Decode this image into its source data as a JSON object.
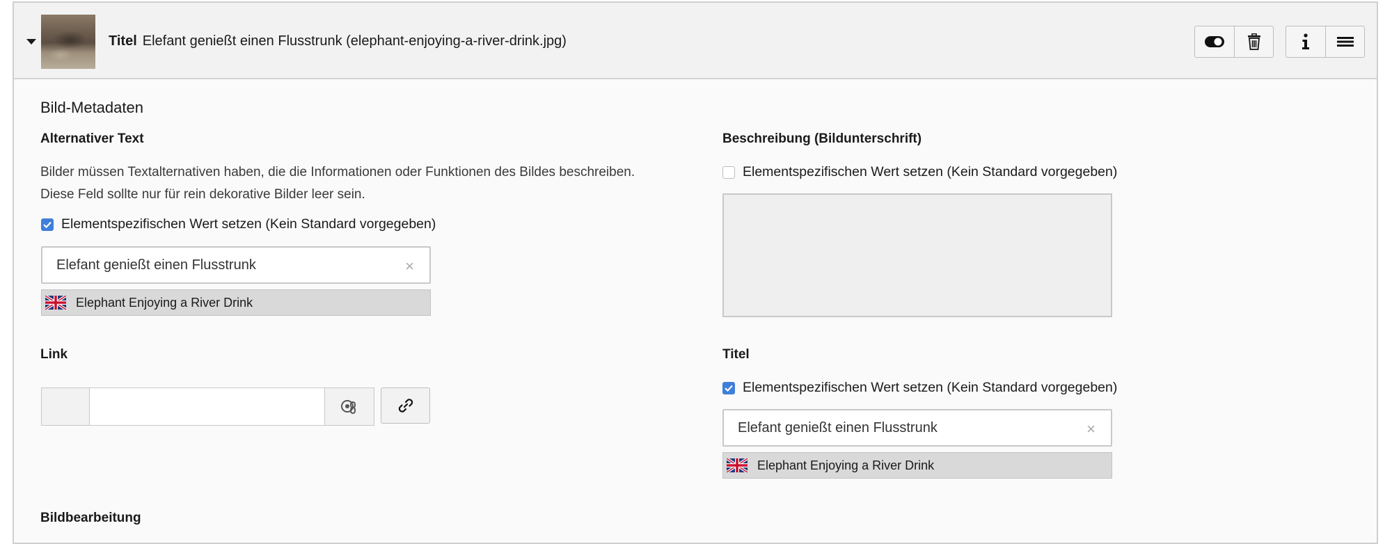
{
  "header": {
    "title_label": "Titel",
    "title_value": "Elefant genießt einen Flusstrunk (elephant-enjoying-a-river-drink.jpg)",
    "buttons": {
      "toggle": "toggle-visibility-icon",
      "delete": "trash-icon",
      "info": "info-icon",
      "menu": "menu-icon"
    }
  },
  "section": {
    "title": "Bild-Metadaten"
  },
  "alt_text": {
    "label": "Alternativer Text",
    "help_line1": "Bilder müssen Textalternativen haben, die die Informationen oder Funktionen des Bildes beschreiben.",
    "help_line2": "Diese Feld sollte nur für rein dekorative Bilder leer sein.",
    "checkbox_label": "Elementspezifischen Wert setzen (Kein Standard vorgegeben)",
    "checked": true,
    "value": "Elefant genießt einen Flusstrunk",
    "clear_symbol": "×",
    "translation": "Elephant Enjoying a River Drink"
  },
  "description": {
    "label": "Beschreibung (Bildunterschrift)",
    "checkbox_label": "Elementspezifischen Wert setzen (Kein Standard vorgegeben)",
    "checked": false
  },
  "link": {
    "label": "Link",
    "value": ""
  },
  "title_field": {
    "label": "Titel",
    "checkbox_label": "Elementspezifischen Wert setzen (Kein Standard vorgegeben)",
    "checked": true,
    "value": "Elefant genießt einen Flusstrunk",
    "clear_symbol": "×",
    "translation": "Elephant Enjoying a River Drink"
  },
  "image_editing": {
    "label": "Bildbearbeitung"
  },
  "colors": {
    "accent": "#3f7fd9",
    "border": "#c8c8c8",
    "header_bg": "#f2f2f2"
  }
}
